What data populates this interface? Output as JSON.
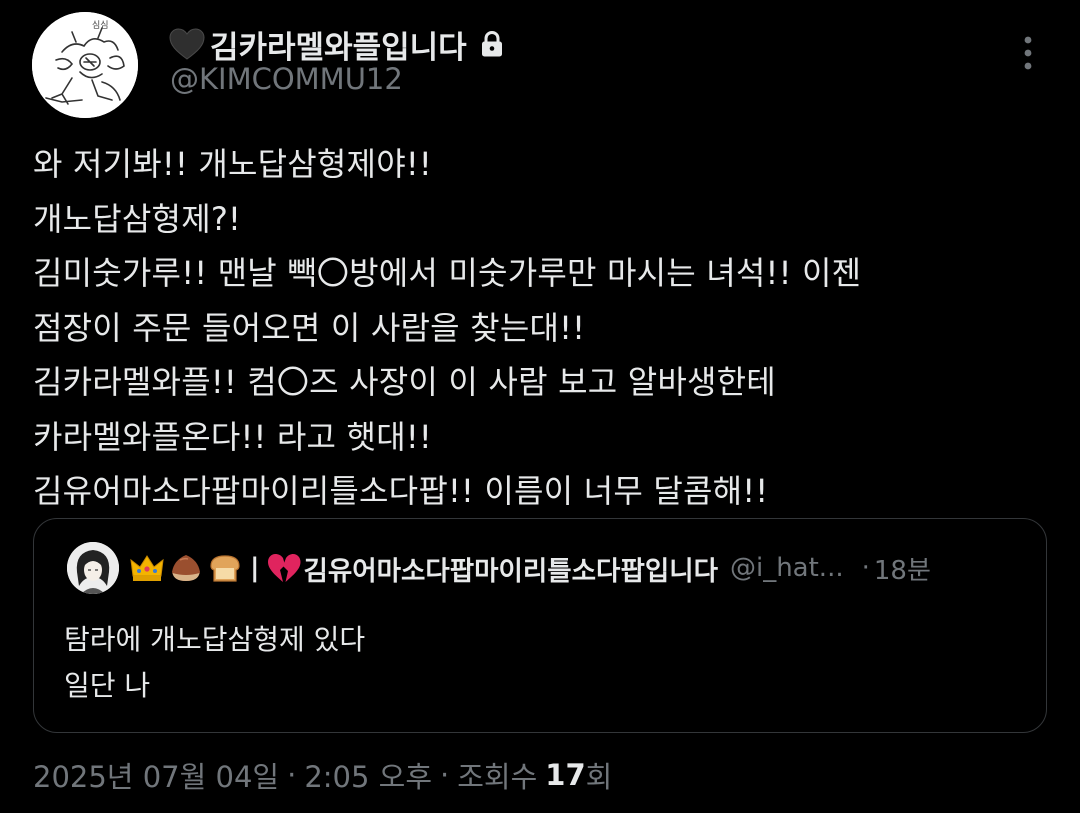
{
  "author": {
    "display_name": "김카라멜와플입니다",
    "handle": "@KIMCOMMU12",
    "name_emoji": "black-heart-icon",
    "protected_icon": "lock-icon",
    "avatar_caption": "심심"
  },
  "menu": {
    "icon": "more-options-icon"
  },
  "tweet": {
    "lines": [
      "와 저기봐!! 개노답삼형제야!!",
      "개노답삼형제?!",
      "김미숫가루!! 맨날 빽〇방에서 미숫가루만 마시는 녀석!! 이젠",
      "점장이 주문 들어오면 이 사람을 찾는대!!",
      "김카라멜와플!! 컴〇즈 사장이 이 사람 보고 알바생한테",
      "카라멜와플온다!! 라고 햇대!!",
      "김유어마소다팝마이리틀소다팝!! 이름이 너무 달콤해!!"
    ]
  },
  "quote": {
    "emojis": [
      "crown-icon",
      "chestnut-icon",
      "bread-icon"
    ],
    "separator": "|",
    "name_emoji": "broken-heart-icon",
    "display_name": "김유어마소다팝마이리틀소다팝입니다",
    "handle": "@i_hat...",
    "dot": "·",
    "time": "18분",
    "lines": [
      "탐라에 개노답삼형제 있다",
      "일단 나"
    ]
  },
  "meta": {
    "date": "2025년 07월 04일",
    "sep1": "·",
    "time": "2:05 오후",
    "sep2": "·",
    "views_label": "조회수",
    "views_count": "17",
    "views_suffix": "회"
  },
  "colors": {
    "background": "#000000",
    "text": "#e7e9ea",
    "secondary": "#71767b",
    "border": "#333639"
  }
}
